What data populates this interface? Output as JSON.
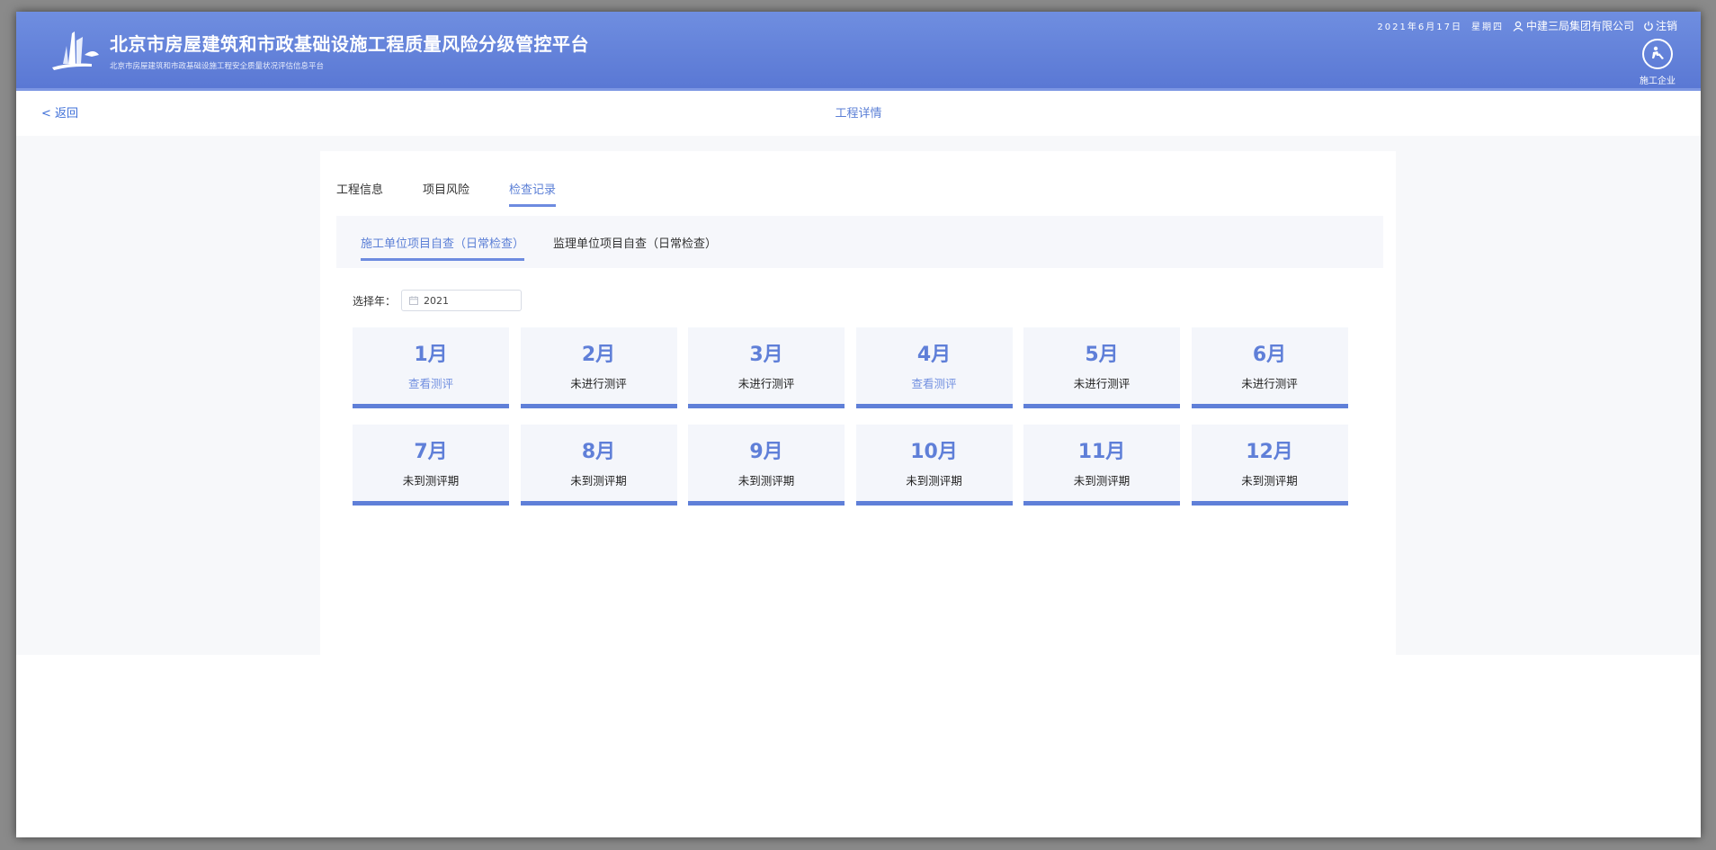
{
  "header": {
    "title": "北京市房屋建筑和市政基础设施工程质量风险分级管控平台",
    "subtitle": "北京市房屋建筑和市政基础设施工程安全质量状况评估信息平台",
    "date": "2021年6月17日",
    "weekday": "星期四",
    "company": "中建三局集团有限公司",
    "logout": "注销",
    "role": "施工企业"
  },
  "subbar": {
    "back": "< 返回",
    "title": "工程详情"
  },
  "tabs": [
    {
      "label": "工程信息",
      "active": false
    },
    {
      "label": "项目风险",
      "active": false
    },
    {
      "label": "检查记录",
      "active": true
    }
  ],
  "subtabs": [
    {
      "label": "施工单位项目自查（日常检查）",
      "active": true
    },
    {
      "label": "监理单位项目自查（日常检查）",
      "active": false
    }
  ],
  "year": {
    "label": "选择年：",
    "value": "2021"
  },
  "months": [
    {
      "name": "1月",
      "status": "查看测评",
      "link": true
    },
    {
      "name": "2月",
      "status": "未进行测评",
      "link": false
    },
    {
      "name": "3月",
      "status": "未进行测评",
      "link": false
    },
    {
      "name": "4月",
      "status": "查看测评",
      "link": true
    },
    {
      "name": "5月",
      "status": "未进行测评",
      "link": false
    },
    {
      "name": "6月",
      "status": "未进行测评",
      "link": false
    },
    {
      "name": "7月",
      "status": "未到测评期",
      "link": false
    },
    {
      "name": "8月",
      "status": "未到测评期",
      "link": false
    },
    {
      "name": "9月",
      "status": "未到测评期",
      "link": false
    },
    {
      "name": "10月",
      "status": "未到测评期",
      "link": false
    },
    {
      "name": "11月",
      "status": "未到测评期",
      "link": false
    },
    {
      "name": "12月",
      "status": "未到测评期",
      "link": false
    }
  ],
  "colors": {
    "header": "#6f8ee0",
    "accent": "#5f7fd8",
    "link": "#7290e0"
  }
}
